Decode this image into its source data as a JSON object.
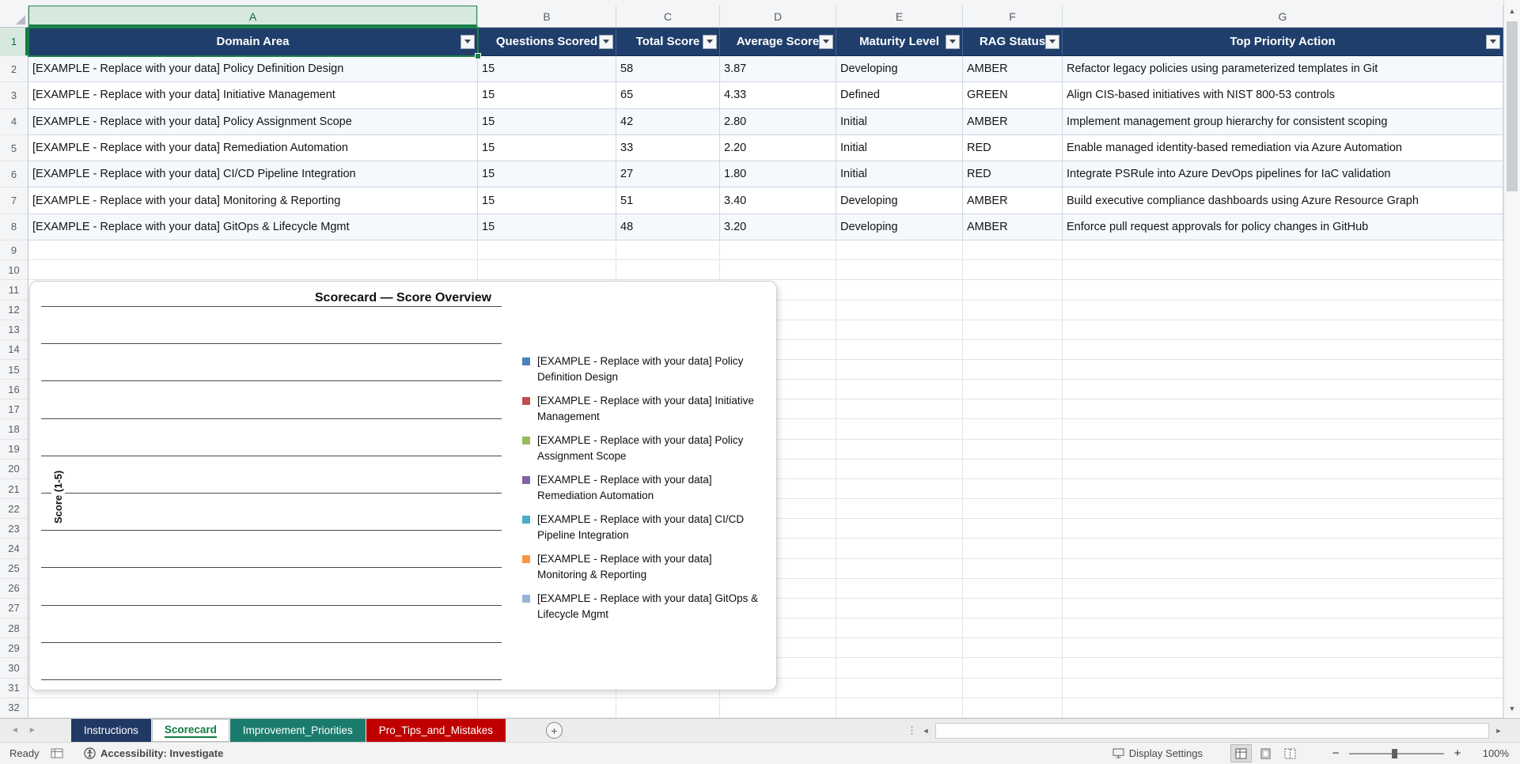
{
  "colors": {
    "table_header_fill": "#1F3E6B",
    "selection_green": "#107C41",
    "chart_series": [
      "#4F81BD",
      "#C0504D",
      "#9BBB59",
      "#8064A2",
      "#4BACC6",
      "#F79646",
      "#95B3D7"
    ]
  },
  "grid": {
    "column_letters": [
      "A",
      "B",
      "C",
      "D",
      "E",
      "F",
      "G"
    ],
    "row_count": 32,
    "selected_column": "A",
    "selected_row": 1,
    "selected_cell": "A1"
  },
  "table": {
    "headers": [
      "Domain Area",
      "Questions Scored",
      "Total Score",
      "Average Score",
      "Maturity Level",
      "RAG Status",
      "Top Priority Action"
    ],
    "rows": [
      [
        "[EXAMPLE - Replace with your data] Policy Definition Design",
        "15",
        "58",
        "3.87",
        "Developing",
        "AMBER",
        "Refactor legacy policies using parameterized templates in Git"
      ],
      [
        "[EXAMPLE - Replace with your data] Initiative Management",
        "15",
        "65",
        "4.33",
        "Defined",
        "GREEN",
        "Align CIS-based initiatives with NIST 800-53 controls"
      ],
      [
        "[EXAMPLE - Replace with your data] Policy Assignment Scope",
        "15",
        "42",
        "2.80",
        "Initial",
        "AMBER",
        "Implement management group hierarchy for consistent scoping"
      ],
      [
        "[EXAMPLE - Replace with your data] Remediation Automation",
        "15",
        "33",
        "2.20",
        "Initial",
        "RED",
        "Enable managed identity-based remediation via Azure Automation"
      ],
      [
        "[EXAMPLE - Replace with your data] CI/CD Pipeline Integration",
        "15",
        "27",
        "1.80",
        "Initial",
        "RED",
        "Integrate PSRule into Azure DevOps pipelines for IaC validation"
      ],
      [
        "[EXAMPLE - Replace with your data] Monitoring & Reporting",
        "15",
        "51",
        "3.40",
        "Developing",
        "AMBER",
        "Build executive compliance dashboards using Azure Resource Graph"
      ],
      [
        "[EXAMPLE - Replace with your data] GitOps & Lifecycle Mgmt",
        "15",
        "48",
        "3.20",
        "Developing",
        "AMBER",
        "Enforce pull request approvals for policy changes in GitHub"
      ]
    ]
  },
  "chart": {
    "title": "Scorecard — Score Overview",
    "y_axis_label": "Score (1-5)",
    "legend_labels": [
      "[EXAMPLE - Replace with your data] Policy Definition Design",
      "[EXAMPLE - Replace with your data] Initiative Management",
      "[EXAMPLE - Replace with your data] Policy Assignment Scope",
      "[EXAMPLE - Replace with your data] Remediation Automation",
      "[EXAMPLE - Replace with your data] CI/CD Pipeline Integration",
      "[EXAMPLE - Replace with your data] Monitoring & Reporting",
      "[EXAMPLE - Replace with your data] GitOps & Lifecycle Mgmt"
    ]
  },
  "chart_data": {
    "type": "bar",
    "title": "Scorecard — Score Overview",
    "ylabel": "Score (1-5)",
    "legend_position": "right",
    "grid": true,
    "gridline_count": 11,
    "series": [
      {
        "name": "[EXAMPLE - Replace with your data] Policy Definition Design",
        "values": []
      },
      {
        "name": "[EXAMPLE - Replace with your data] Initiative Management",
        "values": []
      },
      {
        "name": "[EXAMPLE - Replace with your data] Policy Assignment Scope",
        "values": []
      },
      {
        "name": "[EXAMPLE - Replace with your data] Remediation Automation",
        "values": []
      },
      {
        "name": "[EXAMPLE - Replace with your data] CI/CD Pipeline Integration",
        "values": []
      },
      {
        "name": "[EXAMPLE - Replace with your data] Monitoring & Reporting",
        "values": []
      },
      {
        "name": "[EXAMPLE - Replace with your data] GitOps & Lifecycle Mgmt",
        "values": []
      }
    ],
    "note": "plot area shows horizontal gridlines only; no data bars are visible in the screenshot"
  },
  "sheet_tabs": [
    {
      "label": "Instructions",
      "color": "#1F3864",
      "text_color": "#FFFFFF",
      "active": false
    },
    {
      "label": "Scorecard",
      "color": "#FFFFFF",
      "text_color": "#107C41",
      "active": true
    },
    {
      "label": "Improvement_Priorities",
      "color": "#1B7C6D",
      "text_color": "#FFFFFF",
      "active": false
    },
    {
      "label": "Pro_Tips_and_Mistakes",
      "color": "#C00000",
      "text_color": "#FFFFFF",
      "active": false
    }
  ],
  "status_bar": {
    "ready_label": "Ready",
    "accessibility_label": "Accessibility: Investigate",
    "display_settings_label": "Display Settings",
    "zoom_level": "100%"
  }
}
